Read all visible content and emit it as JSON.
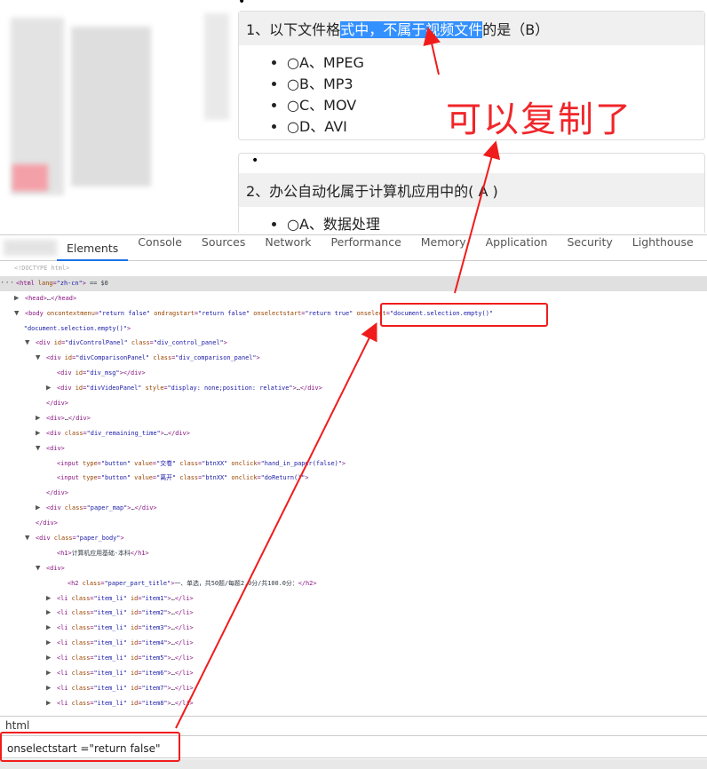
{
  "questions": [
    {
      "prefix": "1、以下文件格",
      "selected": "式中，不属于视频文件",
      "suffix": "的是（B）",
      "options": [
        "○A、MPEG",
        "○B、MP3",
        "○C、MOV",
        "○D、AVI"
      ]
    },
    {
      "prefix": "2、办公自动化属于计算机应用中的( A )",
      "selected": "",
      "suffix": "",
      "options": [
        "○A、数据处理"
      ]
    }
  ],
  "annotation": "可以复制了",
  "devtools": {
    "tabs": [
      "Elements",
      "Console",
      "Sources",
      "Network",
      "Performance",
      "Memory",
      "Application",
      "Security",
      "Lighthouse"
    ],
    "active_tab": "Elements",
    "lines": [
      {
        "d": 0,
        "tog": "",
        "cls": "c",
        "tokens": [
          [
            "c",
            "<!DOCTYPE html>"
          ]
        ]
      },
      {
        "d": 0,
        "tog": "···",
        "hl": true,
        "tokens": [
          [
            "t",
            "<html "
          ],
          [
            "a",
            "lang"
          ],
          [
            "t",
            "="
          ],
          [
            "v",
            "\"zh-cn\""
          ],
          [
            "t",
            ">"
          ],
          [
            "p",
            " == $0"
          ]
        ]
      },
      {
        "d": 1,
        "tog": "▶",
        "tokens": [
          [
            "t",
            "<head>"
          ],
          [
            "p",
            "…"
          ],
          [
            "t",
            "</head>"
          ]
        ]
      },
      {
        "d": 1,
        "tog": "▼",
        "tokens": [
          [
            "t",
            "<body "
          ],
          [
            "a",
            "oncontextmenu"
          ],
          [
            "t",
            "="
          ],
          [
            "v",
            "\"return false\""
          ],
          [
            "p",
            " "
          ],
          [
            "a",
            "ondragstart"
          ],
          [
            "t",
            "="
          ],
          [
            "v",
            "\"return false\""
          ],
          [
            "p",
            " "
          ],
          [
            "a",
            "onselectstart"
          ],
          [
            "t",
            "="
          ],
          [
            "v",
            "\"return true\""
          ],
          [
            "p",
            " "
          ],
          [
            "a",
            "onselect"
          ],
          [
            "t",
            "="
          ],
          [
            "v",
            "\"document.selection.empty()\""
          ]
        ]
      },
      {
        "d": 0.9,
        "tog": "",
        "tokens": [
          [
            "v",
            "\"document.selection.empty()\""
          ],
          [
            "t",
            ">"
          ]
        ]
      },
      {
        "d": 2,
        "tog": "▼",
        "tokens": [
          [
            "t",
            "<div "
          ],
          [
            "a",
            "id"
          ],
          [
            "t",
            "="
          ],
          [
            "v",
            "\"divControlPanel\""
          ],
          [
            "p",
            " "
          ],
          [
            "a",
            "class"
          ],
          [
            "t",
            "="
          ],
          [
            "v",
            "\"div_control_panel\""
          ],
          [
            "t",
            ">"
          ]
        ]
      },
      {
        "d": 3,
        "tog": "▼",
        "tokens": [
          [
            "t",
            "<div "
          ],
          [
            "a",
            "id"
          ],
          [
            "t",
            "="
          ],
          [
            "v",
            "\"divComparisonPanel\""
          ],
          [
            "p",
            " "
          ],
          [
            "a",
            "class"
          ],
          [
            "t",
            "="
          ],
          [
            "v",
            "\"div_comparison_panel\""
          ],
          [
            "t",
            ">"
          ]
        ]
      },
      {
        "d": 4,
        "tog": "",
        "tokens": [
          [
            "t",
            "<div "
          ],
          [
            "a",
            "id"
          ],
          [
            "t",
            "="
          ],
          [
            "v",
            "\"div_msg\""
          ],
          [
            "t",
            "></div>"
          ]
        ]
      },
      {
        "d": 4,
        "tog": "▶",
        "tokens": [
          [
            "t",
            "<div "
          ],
          [
            "a",
            "id"
          ],
          [
            "t",
            "="
          ],
          [
            "v",
            "\"divVideoPanel\""
          ],
          [
            "p",
            " "
          ],
          [
            "a",
            "style"
          ],
          [
            "t",
            "="
          ],
          [
            "v",
            "\"display: none;position: relative\""
          ],
          [
            "t",
            ">"
          ],
          [
            "p",
            "…"
          ],
          [
            "t",
            "</div>"
          ]
        ]
      },
      {
        "d": 3,
        "tog": "",
        "tokens": [
          [
            "t",
            "</div>"
          ]
        ]
      },
      {
        "d": 3,
        "tog": "▶",
        "tokens": [
          [
            "t",
            "<div>"
          ],
          [
            "p",
            "…"
          ],
          [
            "t",
            "</div>"
          ]
        ]
      },
      {
        "d": 3,
        "tog": "▶",
        "tokens": [
          [
            "t",
            "<div "
          ],
          [
            "a",
            "class"
          ],
          [
            "t",
            "="
          ],
          [
            "v",
            "\"div_remaining_time\""
          ],
          [
            "t",
            ">"
          ],
          [
            "p",
            "…"
          ],
          [
            "t",
            "</div>"
          ]
        ]
      },
      {
        "d": 3,
        "tog": "▼",
        "tokens": [
          [
            "t",
            "<div>"
          ]
        ]
      },
      {
        "d": 4,
        "tog": "",
        "tokens": [
          [
            "t",
            "<input "
          ],
          [
            "a",
            "type"
          ],
          [
            "t",
            "="
          ],
          [
            "v",
            "\"button\""
          ],
          [
            "p",
            " "
          ],
          [
            "a",
            "value"
          ],
          [
            "t",
            "="
          ],
          [
            "v",
            "\"交卷\""
          ],
          [
            "p",
            " "
          ],
          [
            "a",
            "class"
          ],
          [
            "t",
            "="
          ],
          [
            "v",
            "\"btnXX\""
          ],
          [
            "p",
            " "
          ],
          [
            "a",
            "onclick"
          ],
          [
            "t",
            "="
          ],
          [
            "v",
            "\"hand_in_paper(false)\""
          ],
          [
            "t",
            ">"
          ]
        ]
      },
      {
        "d": 4,
        "tog": "",
        "tokens": [
          [
            "t",
            "<input "
          ],
          [
            "a",
            "type"
          ],
          [
            "t",
            "="
          ],
          [
            "v",
            "\"button\""
          ],
          [
            "p",
            " "
          ],
          [
            "a",
            "value"
          ],
          [
            "t",
            "="
          ],
          [
            "v",
            "\"离开\""
          ],
          [
            "p",
            " "
          ],
          [
            "a",
            "class"
          ],
          [
            "t",
            "="
          ],
          [
            "v",
            "\"btnXX\""
          ],
          [
            "p",
            " "
          ],
          [
            "a",
            "onclick"
          ],
          [
            "t",
            "="
          ],
          [
            "v",
            "\"doReturn()\""
          ],
          [
            "t",
            ">"
          ]
        ]
      },
      {
        "d": 3,
        "tog": "",
        "tokens": [
          [
            "t",
            "</div>"
          ]
        ]
      },
      {
        "d": 3,
        "tog": "▶",
        "tokens": [
          [
            "t",
            "<div "
          ],
          [
            "a",
            "class"
          ],
          [
            "t",
            "="
          ],
          [
            "v",
            "\"paper_map\""
          ],
          [
            "t",
            ">"
          ],
          [
            "p",
            "…"
          ],
          [
            "t",
            "</div>"
          ]
        ]
      },
      {
        "d": 2,
        "tog": "",
        "tokens": [
          [
            "t",
            "</div>"
          ]
        ]
      },
      {
        "d": 2,
        "tog": "▼",
        "tokens": [
          [
            "t",
            "<div "
          ],
          [
            "a",
            "class"
          ],
          [
            "t",
            "="
          ],
          [
            "v",
            "\"paper_body\""
          ],
          [
            "t",
            ">"
          ]
        ]
      },
      {
        "d": 4,
        "tog": "",
        "tokens": [
          [
            "t",
            "<h1>"
          ],
          [
            "p",
            "计算机应用基础-本科"
          ],
          [
            "t",
            "</h1>"
          ]
        ]
      },
      {
        "d": 3,
        "tog": "▼",
        "tokens": [
          [
            "t",
            "<div>"
          ]
        ]
      },
      {
        "d": 5,
        "tog": "",
        "tokens": [
          [
            "t",
            "<h2 "
          ],
          [
            "a",
            "class"
          ],
          [
            "t",
            "="
          ],
          [
            "v",
            "\"paper_part_title\""
          ],
          [
            "t",
            ">"
          ],
          [
            "p",
            "一、单选，共50题/每题2.0分/共100.0分："
          ],
          [
            "t",
            "</h2>"
          ]
        ]
      },
      {
        "d": 4,
        "tog": "▶",
        "tokens": [
          [
            "t",
            "<li "
          ],
          [
            "a",
            "class"
          ],
          [
            "t",
            "="
          ],
          [
            "v",
            "\"item_li\""
          ],
          [
            "p",
            " "
          ],
          [
            "a",
            "id"
          ],
          [
            "t",
            "="
          ],
          [
            "v",
            "\"item1\""
          ],
          [
            "t",
            ">"
          ],
          [
            "p",
            "…"
          ],
          [
            "t",
            "</li>"
          ]
        ]
      },
      {
        "d": 4,
        "tog": "▶",
        "tokens": [
          [
            "t",
            "<li "
          ],
          [
            "a",
            "class"
          ],
          [
            "t",
            "="
          ],
          [
            "v",
            "\"item_li\""
          ],
          [
            "p",
            " "
          ],
          [
            "a",
            "id"
          ],
          [
            "t",
            "="
          ],
          [
            "v",
            "\"item2\""
          ],
          [
            "t",
            ">"
          ],
          [
            "p",
            "…"
          ],
          [
            "t",
            "</li>"
          ]
        ]
      },
      {
        "d": 4,
        "tog": "▶",
        "tokens": [
          [
            "t",
            "<li "
          ],
          [
            "a",
            "class"
          ],
          [
            "t",
            "="
          ],
          [
            "v",
            "\"item_li\""
          ],
          [
            "p",
            " "
          ],
          [
            "a",
            "id"
          ],
          [
            "t",
            "="
          ],
          [
            "v",
            "\"item3\""
          ],
          [
            "t",
            ">"
          ],
          [
            "p",
            "…"
          ],
          [
            "t",
            "</li>"
          ]
        ]
      },
      {
        "d": 4,
        "tog": "▶",
        "tokens": [
          [
            "t",
            "<li "
          ],
          [
            "a",
            "class"
          ],
          [
            "t",
            "="
          ],
          [
            "v",
            "\"item_li\""
          ],
          [
            "p",
            " "
          ],
          [
            "a",
            "id"
          ],
          [
            "t",
            "="
          ],
          [
            "v",
            "\"item4\""
          ],
          [
            "t",
            ">"
          ],
          [
            "p",
            "…"
          ],
          [
            "t",
            "</li>"
          ]
        ]
      },
      {
        "d": 4,
        "tog": "▶",
        "tokens": [
          [
            "t",
            "<li "
          ],
          [
            "a",
            "class"
          ],
          [
            "t",
            "="
          ],
          [
            "v",
            "\"item_li\""
          ],
          [
            "p",
            " "
          ],
          [
            "a",
            "id"
          ],
          [
            "t",
            "="
          ],
          [
            "v",
            "\"item5\""
          ],
          [
            "t",
            ">"
          ],
          [
            "p",
            "…"
          ],
          [
            "t",
            "</li>"
          ]
        ]
      },
      {
        "d": 4,
        "tog": "▶",
        "tokens": [
          [
            "t",
            "<li "
          ],
          [
            "a",
            "class"
          ],
          [
            "t",
            "="
          ],
          [
            "v",
            "\"item_li\""
          ],
          [
            "p",
            " "
          ],
          [
            "a",
            "id"
          ],
          [
            "t",
            "="
          ],
          [
            "v",
            "\"item6\""
          ],
          [
            "t",
            ">"
          ],
          [
            "p",
            "…"
          ],
          [
            "t",
            "</li>"
          ]
        ]
      },
      {
        "d": 4,
        "tog": "▶",
        "tokens": [
          [
            "t",
            "<li "
          ],
          [
            "a",
            "class"
          ],
          [
            "t",
            "="
          ],
          [
            "v",
            "\"item_li\""
          ],
          [
            "p",
            " "
          ],
          [
            "a",
            "id"
          ],
          [
            "t",
            "="
          ],
          [
            "v",
            "\"item7\""
          ],
          [
            "t",
            ">"
          ],
          [
            "p",
            "…"
          ],
          [
            "t",
            "</li>"
          ]
        ]
      },
      {
        "d": 4,
        "tog": "▶",
        "tokens": [
          [
            "t",
            "<li "
          ],
          [
            "a",
            "class"
          ],
          [
            "t",
            "="
          ],
          [
            "v",
            "\"item_li\""
          ],
          [
            "p",
            " "
          ],
          [
            "a",
            "id"
          ],
          [
            "t",
            "="
          ],
          [
            "v",
            "\"item8\""
          ],
          [
            "t",
            ">"
          ],
          [
            "p",
            "…"
          ],
          [
            "t",
            "</li>"
          ]
        ]
      }
    ],
    "breadcrumb": "html",
    "console_input": "onselectstart =\"return false\"",
    "highlight_color": "#f01c1c"
  }
}
